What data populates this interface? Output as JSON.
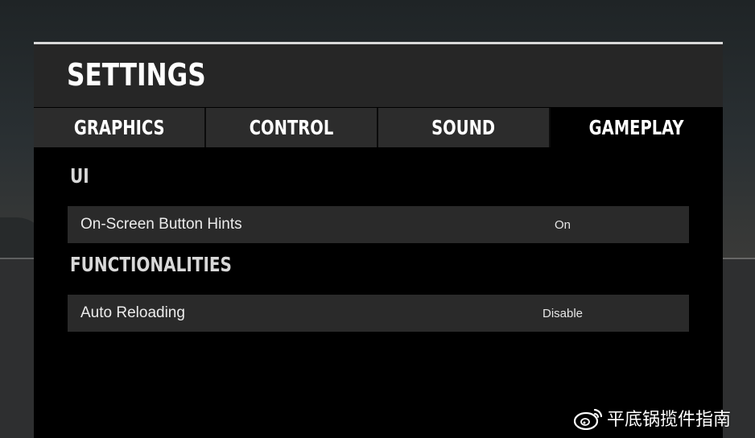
{
  "settings": {
    "title": "SETTINGS",
    "tabs": [
      {
        "label": "GRAPHICS",
        "active": false
      },
      {
        "label": "CONTROL",
        "active": false
      },
      {
        "label": "SOUND",
        "active": false
      },
      {
        "label": "GAMEPLAY",
        "active": true
      }
    ],
    "sections": [
      {
        "label": "UI",
        "rows": [
          {
            "name": "On-Screen Button Hints",
            "value": "On"
          }
        ]
      },
      {
        "label": "FUNCTIONALITIES",
        "rows": [
          {
            "name": "Auto Reloading",
            "value": "Disable"
          }
        ]
      }
    ]
  },
  "watermark": {
    "text": "平底锅揽件指南",
    "icon": "weibo-icon"
  },
  "colors": {
    "panel_bg": "#000000",
    "header_bg": "#262626",
    "tab_bg": "#2c2c2c",
    "row_bg": "#2a2a2a",
    "text": "#ffffff"
  }
}
